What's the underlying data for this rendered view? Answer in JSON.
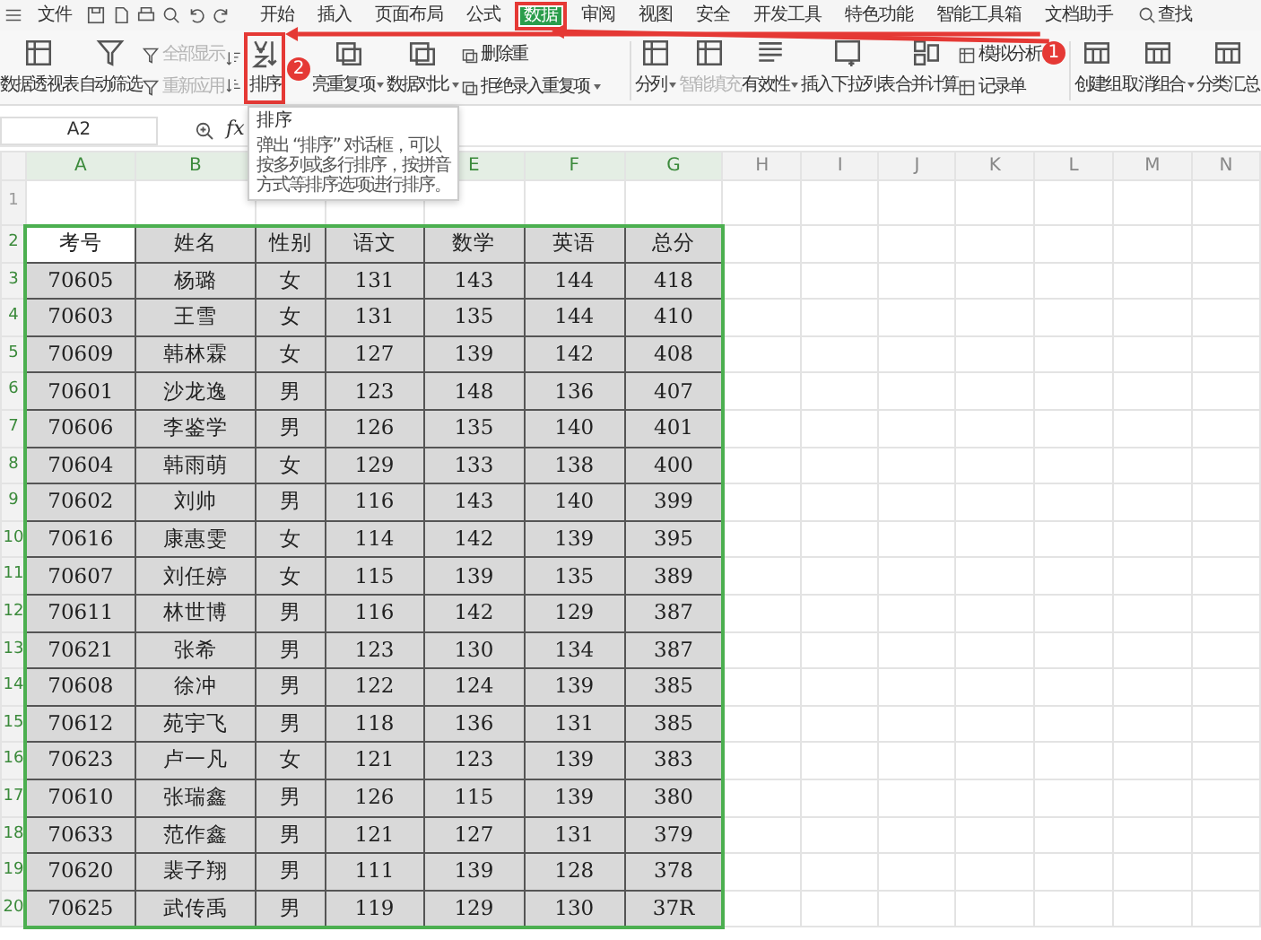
{
  "menu_bar": {
    "file_menu": "文件",
    "tabs": [
      {
        "label": "开始",
        "selected": false,
        "highlighted": false
      },
      {
        "label": "插入",
        "selected": false,
        "highlighted": false
      },
      {
        "label": "页面布局",
        "selected": false,
        "highlighted": false
      },
      {
        "label": "公式",
        "selected": false,
        "highlighted": false
      },
      {
        "label": "数据",
        "selected": true,
        "highlighted": true
      },
      {
        "label": "审阅",
        "selected": false,
        "highlighted": false
      },
      {
        "label": "视图",
        "selected": false,
        "highlighted": false
      },
      {
        "label": "安全",
        "selected": false,
        "highlighted": false
      },
      {
        "label": "开发工具",
        "selected": false,
        "highlighted": false
      },
      {
        "label": "特色功能",
        "selected": false,
        "highlighted": false
      },
      {
        "label": "智能工具箱",
        "selected": false,
        "highlighted": false
      },
      {
        "label": "文档助手",
        "selected": false,
        "highlighted": false
      }
    ],
    "search": "查找"
  },
  "ribbon": [
    {
      "kind": "large",
      "label": "数据透视表",
      "disabled": false,
      "dropdown": false,
      "highlighted": false
    },
    {
      "kind": "large",
      "label": "自动筛选",
      "disabled": false,
      "dropdown": false,
      "highlighted": false
    },
    {
      "kind": "stack",
      "items": [
        {
          "label": "全部显示",
          "disabled": true,
          "dropdown": false
        },
        {
          "label": "重新应用",
          "disabled": true,
          "dropdown": false
        }
      ]
    },
    {
      "kind": "sort_icons"
    },
    {
      "kind": "large",
      "label": "排序",
      "disabled": false,
      "dropdown": false,
      "highlighted": true
    },
    {
      "kind": "large",
      "label": "亮重复项",
      "disabled": false,
      "dropdown": true,
      "highlighted": false
    },
    {
      "kind": "large",
      "label": "数据对比",
      "disabled": false,
      "dropdown": true,
      "highlighted": false
    },
    {
      "kind": "stack",
      "items": [
        {
          "label": "删除重",
          "disabled": false,
          "dropdown": false
        },
        {
          "label": "拒绝录入重复项",
          "disabled": false,
          "dropdown": true
        }
      ]
    },
    {
      "kind": "divider"
    },
    {
      "kind": "large",
      "label": "分列",
      "disabled": false,
      "dropdown": true,
      "highlighted": false
    },
    {
      "kind": "large",
      "label": "智能填充",
      "disabled": true,
      "dropdown": false,
      "highlighted": false
    },
    {
      "kind": "large",
      "label": "有效性",
      "disabled": false,
      "dropdown": true,
      "highlighted": false
    },
    {
      "kind": "large",
      "label": "插入下拉列表",
      "disabled": false,
      "dropdown": false,
      "highlighted": false
    },
    {
      "kind": "large",
      "label": "合并计算",
      "disabled": false,
      "dropdown": false,
      "highlighted": false
    },
    {
      "kind": "stack",
      "items": [
        {
          "label": "模拟分析",
          "disabled": false,
          "dropdown": false
        },
        {
          "label": "记录单",
          "disabled": false,
          "dropdown": false
        }
      ]
    },
    {
      "kind": "divider"
    },
    {
      "kind": "large",
      "label": "创建组",
      "disabled": false,
      "dropdown": false,
      "highlighted": false
    },
    {
      "kind": "large",
      "label": "取消组合",
      "disabled": false,
      "dropdown": true,
      "highlighted": false
    },
    {
      "kind": "large",
      "label": "分类汇总",
      "disabled": false,
      "dropdown": false,
      "highlighted": false
    }
  ],
  "formula_bar": {
    "cell_ref": "A2",
    "fx": "fx"
  },
  "tooltip": {
    "title": "排序",
    "text": "弹出 “排序” 对话框，可以按多列或多行排序，按拼音方式等排序选项进行排序。"
  },
  "annotations": [
    {
      "badge": "1"
    },
    {
      "badge": "2"
    }
  ],
  "sheet": {
    "columns_left": [
      "A",
      "B"
    ],
    "columns_right": [
      "E",
      "F",
      "G",
      "H",
      "I",
      "J",
      "K",
      "L",
      "M",
      "N"
    ],
    "row_numbers": [
      "1",
      "2",
      "3",
      "4",
      "5",
      "6",
      "7",
      "8",
      "9",
      "10",
      "11",
      "12",
      "13",
      "14",
      "15",
      "16",
      "17",
      "18",
      "19",
      "20"
    ],
    "header": [
      {
        "text": "考号",
        "active": true
      },
      {
        "text": "姓名",
        "active": false
      },
      {
        "text": "性别",
        "active": false
      },
      {
        "text": "语文",
        "active": false
      },
      {
        "text": "数学",
        "active": false
      },
      {
        "text": "英语",
        "active": false
      },
      {
        "text": "总分",
        "active": false
      }
    ],
    "rows": [
      [
        "70605",
        "杨璐",
        "女",
        "131",
        "143",
        "144",
        "418"
      ],
      [
        "70603",
        "王雪",
        "女",
        "131",
        "135",
        "144",
        "410"
      ],
      [
        "70609",
        "韩林霖",
        "女",
        "127",
        "139",
        "142",
        "408"
      ],
      [
        "70601",
        "沙龙逸",
        "男",
        "123",
        "148",
        "136",
        "407"
      ],
      [
        "70606",
        "李鉴学",
        "男",
        "126",
        "135",
        "140",
        "401"
      ],
      [
        "70604",
        "韩雨萌",
        "女",
        "129",
        "133",
        "138",
        "400"
      ],
      [
        "70602",
        "刘帅",
        "男",
        "116",
        "143",
        "140",
        "399"
      ],
      [
        "70616",
        "康惠雯",
        "女",
        "114",
        "142",
        "139",
        "395"
      ],
      [
        "70607",
        "刘任婷",
        "女",
        "115",
        "139",
        "135",
        "389"
      ],
      [
        "70611",
        "林世博",
        "男",
        "116",
        "142",
        "129",
        "387"
      ],
      [
        "70621",
        "张希",
        "男",
        "123",
        "130",
        "134",
        "387"
      ],
      [
        "70608",
        "徐冲",
        "男",
        "122",
        "124",
        "139",
        "385"
      ],
      [
        "70612",
        "苑宇飞",
        "男",
        "118",
        "136",
        "131",
        "385"
      ],
      [
        "70623",
        "卢一凡",
        "女",
        "121",
        "123",
        "139",
        "383"
      ],
      [
        "70610",
        "张瑞鑫",
        "男",
        "126",
        "115",
        "139",
        "380"
      ],
      [
        "70633",
        "范作鑫",
        "男",
        "121",
        "127",
        "131",
        "379"
      ],
      [
        "70620",
        "裴子翔",
        "男",
        "111",
        "139",
        "128",
        "378"
      ],
      [
        "70625",
        "武传禹",
        "男",
        "119",
        "129",
        "130",
        "37R"
      ]
    ]
  }
}
